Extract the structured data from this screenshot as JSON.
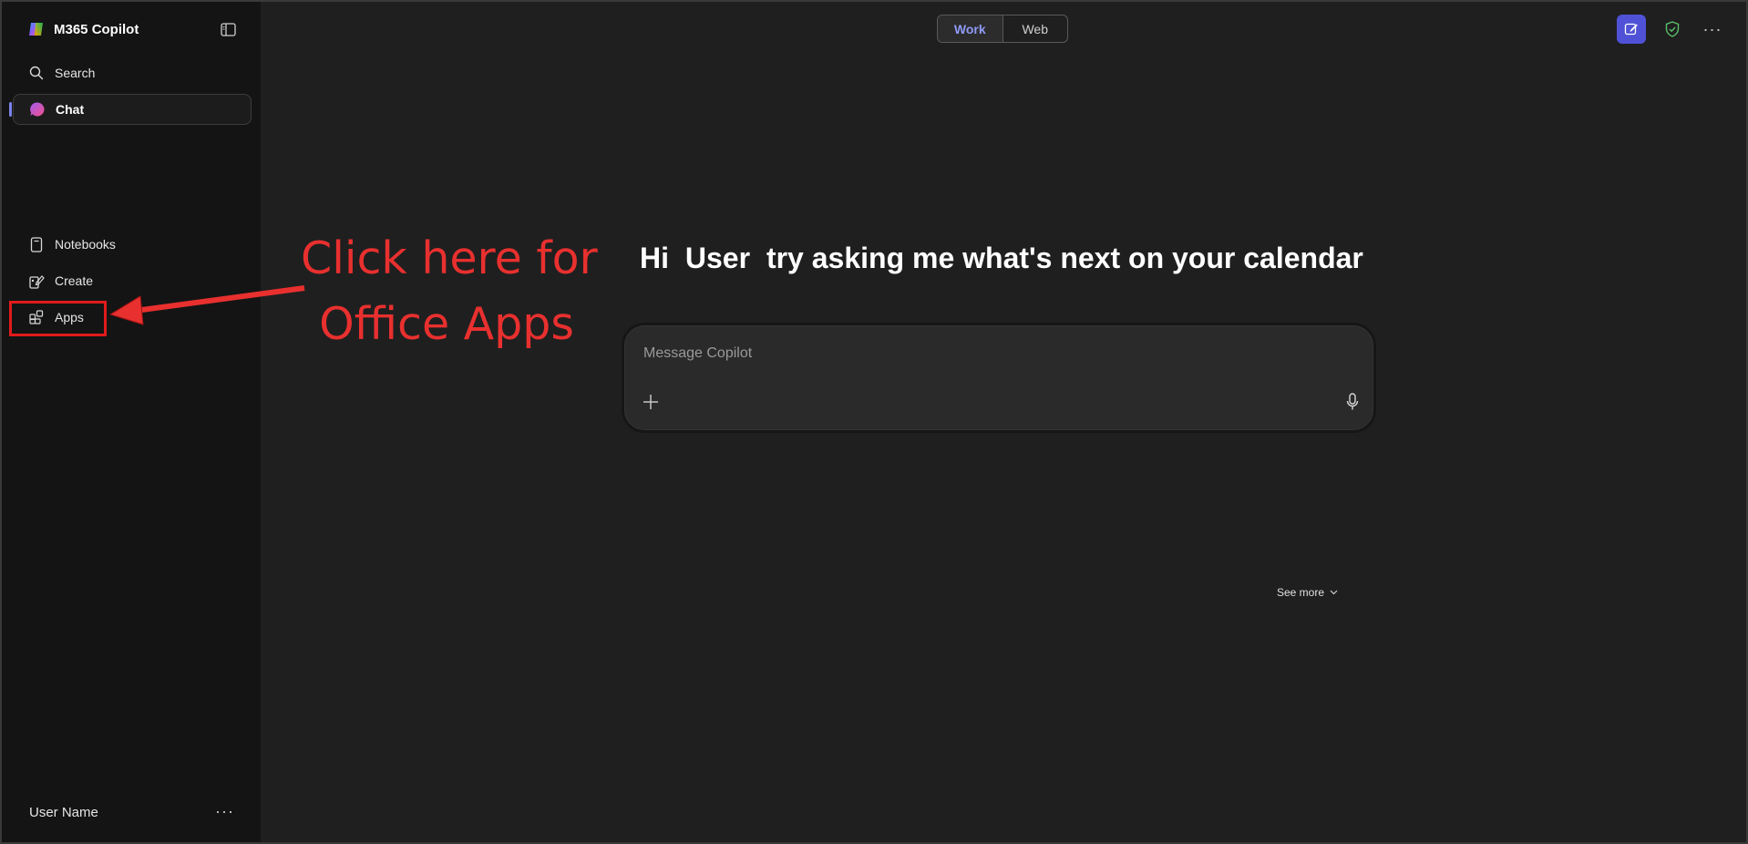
{
  "app": {
    "title": "M365 Copilot"
  },
  "sidebar": {
    "items": [
      {
        "label": "Search",
        "icon": "search-icon"
      },
      {
        "label": "Chat",
        "icon": "copilot-chat-icon",
        "active": true
      },
      {
        "label": "Notebooks",
        "icon": "notebook-icon"
      },
      {
        "label": "Create",
        "icon": "create-icon"
      },
      {
        "label": "Apps",
        "icon": "apps-icon"
      }
    ],
    "user": {
      "name": "User Name",
      "more": "···"
    }
  },
  "topbar": {
    "toggle": [
      "Work",
      "Web"
    ],
    "selected": "Work",
    "more": "···"
  },
  "main": {
    "greeting": {
      "hi": "Hi",
      "user": "User",
      "prompt": "try asking me what's next on your calendar"
    },
    "composer": {
      "placeholder": "Message Copilot"
    },
    "see_more": "See more"
  },
  "annotation": {
    "line1": "Click here for",
    "line2": "Office Apps"
  },
  "colors": {
    "accent": "#4f52d6",
    "annotation": "#e8302f",
    "highlight": "#e01b1b",
    "toggle_selected": "#8f9af7"
  }
}
